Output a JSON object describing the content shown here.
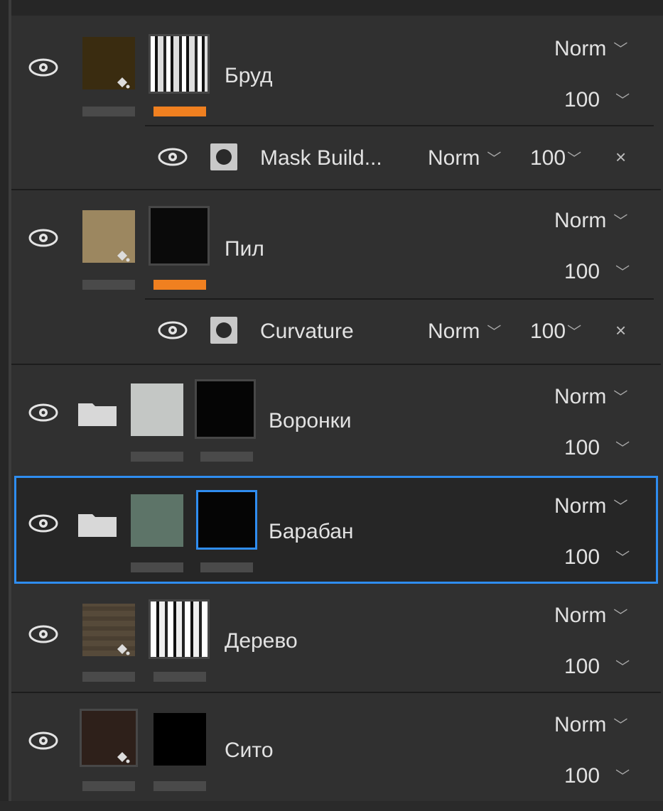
{
  "layers": [
    {
      "name": "Бруд",
      "blend": "Norm",
      "opacity": "100"
    },
    {
      "name": "Пил",
      "blend": "Norm",
      "opacity": "100"
    },
    {
      "name": "Воронки",
      "blend": "Norm",
      "opacity": "100"
    },
    {
      "name": "Барабан",
      "blend": "Norm",
      "opacity": "100"
    },
    {
      "name": "Дерево",
      "blend": "Norm",
      "opacity": "100"
    },
    {
      "name": "Сито",
      "blend": "Norm",
      "opacity": "100"
    }
  ],
  "sublayers": [
    {
      "name": "Mask Build...",
      "blend": "Norm",
      "opacity": "100",
      "close": "×"
    },
    {
      "name": "Curvature",
      "blend": "Norm",
      "opacity": "100",
      "close": "×"
    }
  ],
  "colors": {
    "accent": "#2f8df0",
    "mask_bar": "#f08020",
    "bg": "#303030"
  }
}
